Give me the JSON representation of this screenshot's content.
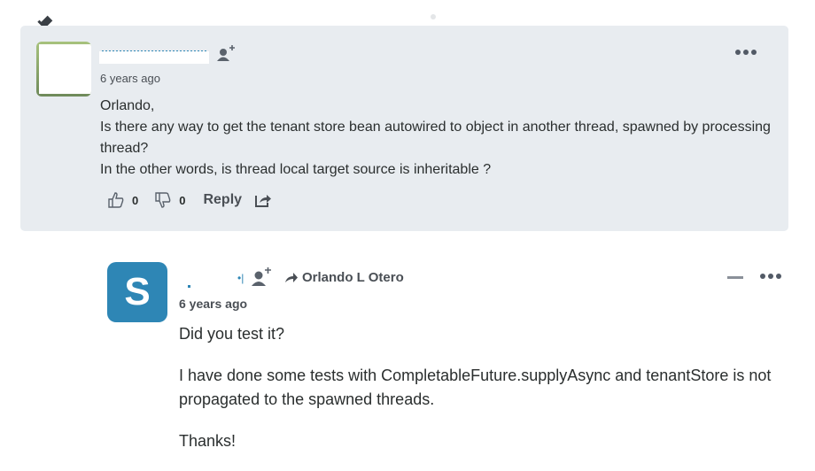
{
  "comments": [
    {
      "pinned": true,
      "author": "",
      "timestamp": "6 years ago",
      "body": [
        "Orlando,",
        "Is there any way to get the tenant store bean autowired to object in another thread, spawned by processing thread?",
        "In the other words, is thread local target source is inheritable ?"
      ],
      "upvotes": "0",
      "downvotes": "0",
      "reply_label": "Reply",
      "icons": {
        "pin": "pin-icon",
        "follow": "follow-user-icon",
        "menu": "more-options-icon",
        "upvote": "thumbs-up-icon",
        "downvote": "thumbs-down-icon",
        "share": "share-icon"
      }
    },
    {
      "avatar_letter": "S",
      "author": "",
      "reply_to": "Orlando L Otero",
      "timestamp": "6 years ago",
      "body": [
        "Did you test it?",
        "I have done some tests with CompletableFuture.supplyAsync and tenantStore is not propagated to the spawned threads.",
        "Thanks!"
      ],
      "icons": {
        "follow": "follow-user-icon",
        "reply_arrow": "reply-arrow-icon",
        "collapse": "collapse-icon",
        "menu": "more-options-icon"
      }
    }
  ],
  "colors": {
    "card_bg": "#e8ecf0",
    "accent": "#2e86b5",
    "text": "#2a2e2e",
    "muted": "#4a4f55"
  }
}
